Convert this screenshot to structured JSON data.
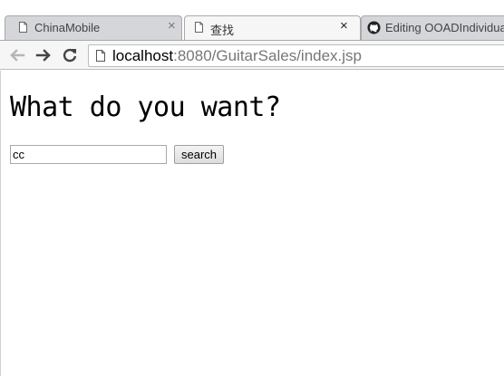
{
  "browser": {
    "tabs": [
      {
        "title": "ChinaMobile",
        "icon": "page-icon",
        "active": false
      },
      {
        "title": "查找",
        "icon": "page-icon",
        "active": true
      },
      {
        "title": "Editing OOADIndividual",
        "icon": "github-icon",
        "active": false
      }
    ],
    "close_glyph": "×",
    "address": {
      "host": "localhost",
      "rest": ":8080/GuitarSales/index.jsp"
    }
  },
  "page": {
    "heading": "What do you want?",
    "search": {
      "value": "cc",
      "button_label": "search"
    }
  }
}
